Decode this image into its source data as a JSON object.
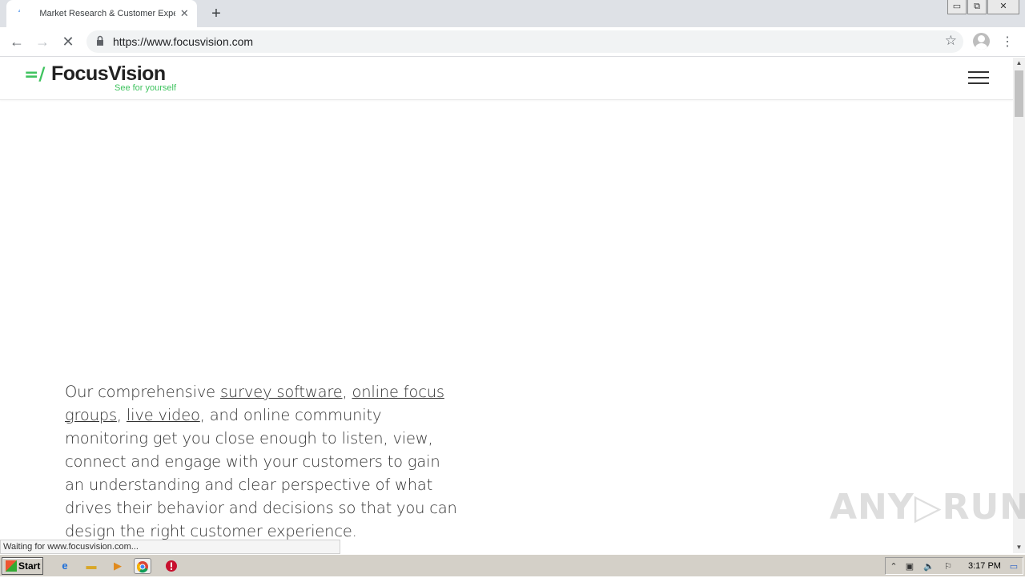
{
  "browser": {
    "tab_title": "Market Research & Customer Experi",
    "tab_close": "✕",
    "new_tab": "+",
    "url": "https://www.focusvision.com",
    "back": "←",
    "forward": "→",
    "reload": "✕",
    "star": "☆",
    "menu": "⋮",
    "status_text": "Waiting for www.focusvision.com..."
  },
  "window_controls": {
    "minimize": "▭",
    "restore": "⧉",
    "close": "✕"
  },
  "site": {
    "logo_mark": "=/",
    "logo_name": "FocusVision",
    "logo_tagline": "See for yourself",
    "intro": {
      "prefix": "Our comprehensive ",
      "link1": "survey software",
      "sep1": ", ",
      "link2": "online focus groups",
      "sep2": ", ",
      "link3": "live video",
      "suffix": ", and online community monitoring get you close enough to listen, view, connect and engage with your customers to gain an understanding and clear perspective of what drives their behavior and decisions so that you can design the right customer experience."
    }
  },
  "watermark": "ANY▷RUN",
  "taskbar": {
    "start_label": "Start",
    "clock": "3:17 PM",
    "icons": [
      "ie-icon",
      "folder-icon",
      "media-icon",
      "chrome-icon",
      "stop-icon"
    ]
  },
  "colors": {
    "brand_green": "#3fc35f",
    "tab_strip": "#dee1e6",
    "taskbar": "#d4d0c8"
  }
}
